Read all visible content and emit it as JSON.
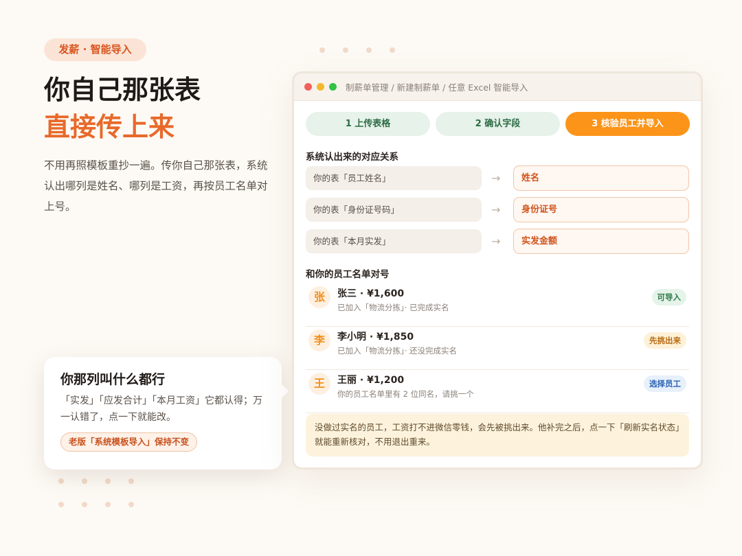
{
  "hero": {
    "badge": "发薪 · 智能导入",
    "title_line1": "你自己那张表",
    "title_line2": "直接传上来",
    "description": "不用再照模板重抄一遍。传你自己那张表，系统认出哪列是姓名、哪列是工资，再按员工名单对上号。"
  },
  "callout": {
    "title": "你那列叫什么都行",
    "text": "「实发」「应发合计」「本月工资」它都认得；万一认错了，点一下就能改。",
    "tag": "老版「系统模板导入」保持不变"
  },
  "window": {
    "breadcrumb": "制薪单管理 / 新建制薪单 / 任意 Excel 智能导入",
    "steps": [
      {
        "label": "1 上传表格"
      },
      {
        "label": "2 确认字段"
      },
      {
        "label": "3 核验员工并导入"
      }
    ],
    "mapping_title": "系统认出来的对应关系",
    "mappings": [
      {
        "source": "你的表「员工姓名」",
        "arrow": "→",
        "target": "姓名"
      },
      {
        "source": "你的表「身份证号码」",
        "arrow": "→",
        "target": "身份证号"
      },
      {
        "source": "你的表「本月实发」",
        "arrow": "→",
        "target": "实发金额"
      }
    ],
    "roster_title": "和你的员工名单对号",
    "employees": [
      {
        "avatar": "张",
        "name": "张三 · ¥1,600",
        "detail": "已加入「物流分拣」· 已完成实名",
        "status": "可导入"
      },
      {
        "avatar": "李",
        "name": "李小明 · ¥1,850",
        "detail": "已加入「物流分拣」· 还没完成实名",
        "status": "先挑出来"
      },
      {
        "avatar": "王",
        "name": "王丽 · ¥1,200",
        "detail": "你的员工名单里有 2 位同名，请挑一个",
        "status": "选择员工"
      }
    ],
    "notice": "没做过实名的员工，工资打不进微信零钱，会先被挑出来。他补完之后，点一下「刷新实名状态」就能重新核对，不用退出重来。"
  },
  "colors": {
    "accent": "#e8692a",
    "step_active": "#fb9419",
    "step_inactive": "#e6f2ea",
    "traffic_red": "#f3605a",
    "traffic_yellow": "#f5b82a",
    "traffic_green": "#33c148"
  }
}
